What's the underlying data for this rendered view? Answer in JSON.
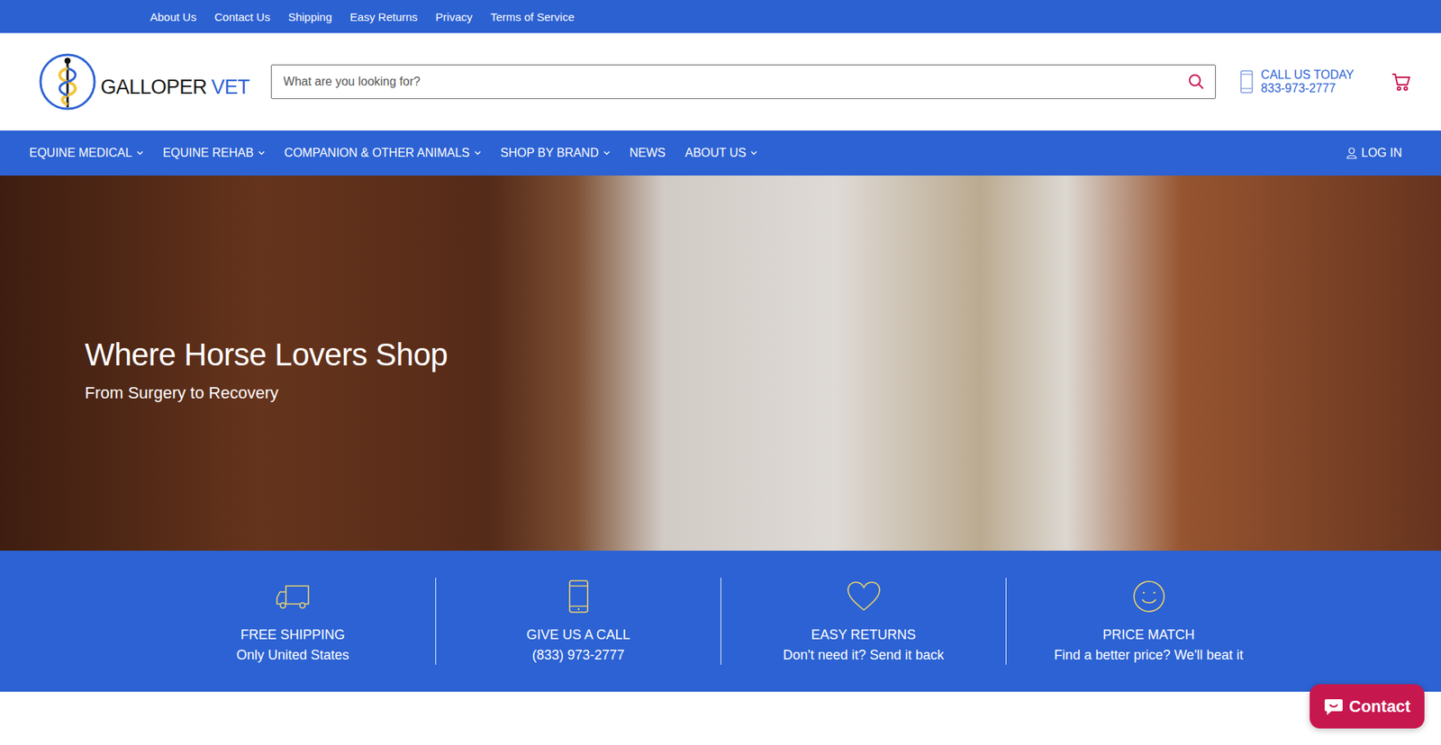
{
  "top_links": [
    "About Us",
    "Contact Us",
    "Shipping",
    "Easy Returns",
    "Privacy",
    "Terms of Service"
  ],
  "logo": {
    "name": "GALLOPER",
    "suffix": "VET"
  },
  "search": {
    "placeholder": "What are you looking for?"
  },
  "call": {
    "label": "CALL US TODAY",
    "phone": "833-973-2777"
  },
  "nav": [
    {
      "label": "EQUINE MEDICAL",
      "has_menu": true
    },
    {
      "label": "EQUINE REHAB",
      "has_menu": true
    },
    {
      "label": "COMPANION & OTHER ANIMALS",
      "has_menu": true
    },
    {
      "label": "SHOP BY BRAND",
      "has_menu": true
    },
    {
      "label": "NEWS",
      "has_menu": false
    },
    {
      "label": "ABOUT US",
      "has_menu": true
    }
  ],
  "login": "LOG IN",
  "hero": {
    "title": "Where Horse Lovers Shop",
    "subtitle": "From Surgery to Recovery"
  },
  "features": [
    {
      "kind": "truck",
      "title": "FREE SHIPPING",
      "text": "Only United States"
    },
    {
      "kind": "phone",
      "title": "GIVE US A CALL",
      "text": "(833) 973-2777"
    },
    {
      "kind": "heart",
      "title": "EASY RETURNS",
      "text": "Don't need it? Send it back"
    },
    {
      "kind": "smile",
      "title": "PRICE MATCH",
      "text": "Find a better price? We'll beat it"
    }
  ],
  "chat": {
    "label": "Contact"
  }
}
